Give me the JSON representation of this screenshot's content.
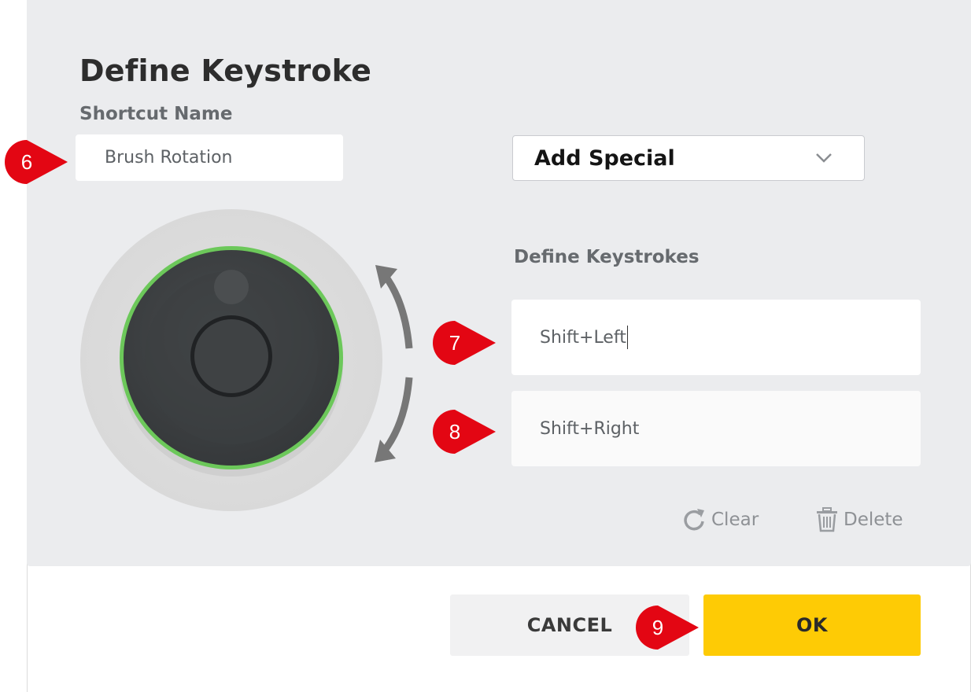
{
  "dialog": {
    "title": "Define Keystroke",
    "shortcut_label": "Shortcut Name",
    "shortcut_value": "Brush Rotation",
    "add_special_label": "Add Special",
    "keystrokes_label": "Define Keystrokes",
    "keystroke_1": "Shift+Left",
    "keystroke_2": "Shift+Right",
    "clear_label": "Clear",
    "delete_label": "Delete",
    "cancel_label": "CANCEL",
    "ok_label": "OK"
  },
  "callouts": [
    "6",
    "7",
    "8",
    "9"
  ],
  "icons": {
    "dropdown": "chevron-down-icon",
    "clear": "refresh-icon",
    "delete": "trash-icon",
    "dial": "rotary-dial-icon"
  },
  "colors": {
    "panel_bg": "#ebecee",
    "ok_button": "#fecb05",
    "dial_ring": "#6cc85a",
    "callout": "#e30613"
  }
}
